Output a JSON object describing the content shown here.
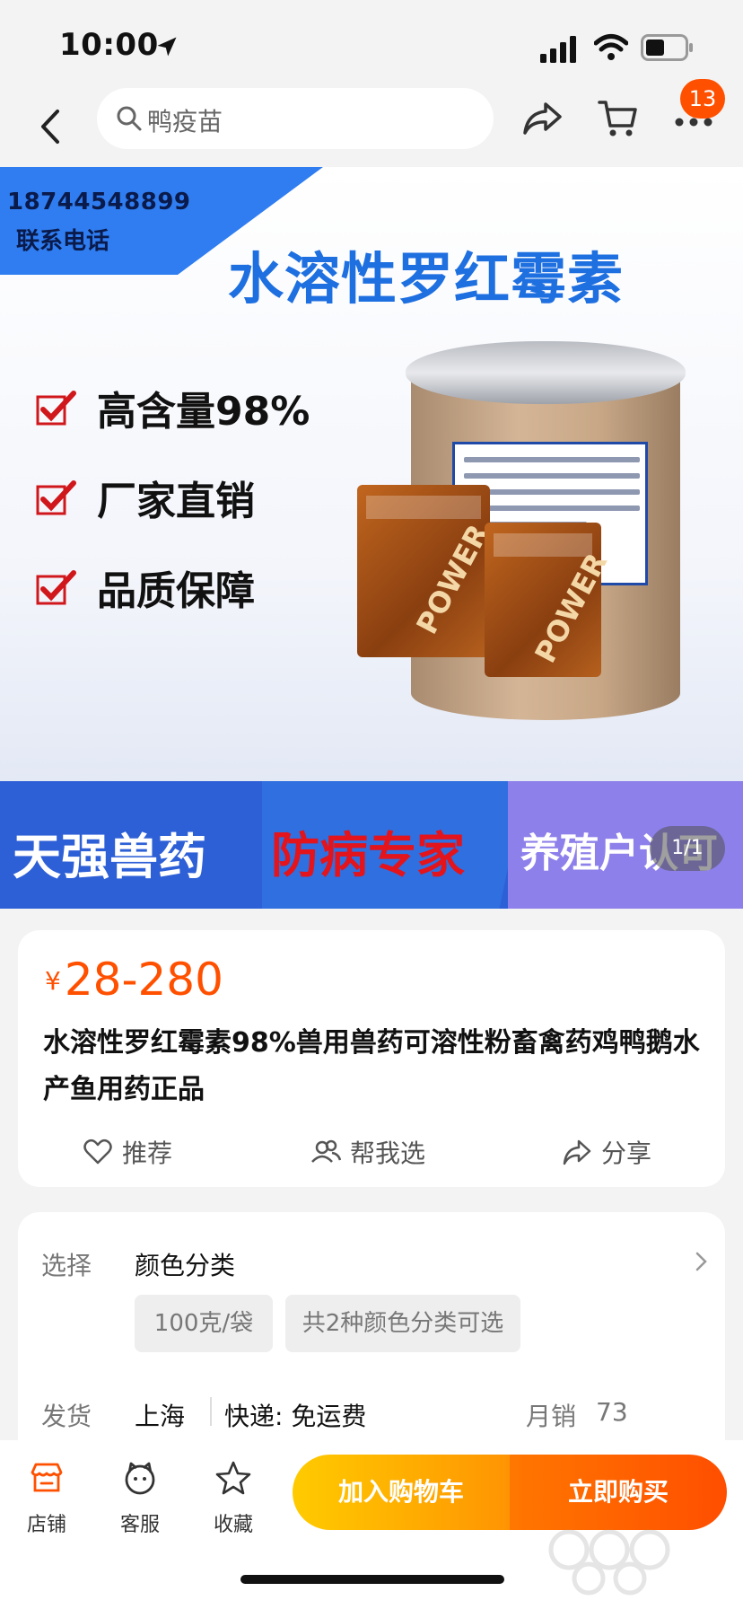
{
  "status": {
    "time": "10:00"
  },
  "nav": {
    "search_text": "鸭疫苗",
    "cart_badge": "13"
  },
  "hero": {
    "phone": "18744548899",
    "phone_label": "联系电话",
    "title": "水溶性罗红霉素",
    "checks": [
      "高含量98%",
      "厂家直销",
      "品质保障"
    ],
    "packet_text": "POWER",
    "banner": [
      "天强兽药",
      "防病专家",
      "养殖户认可"
    ],
    "pager": "1/1"
  },
  "product": {
    "currency": "¥",
    "price": "28-280",
    "title": "水溶性罗红霉素98%兽用兽药可溶性粉畜禽药鸡鸭鹅水产鱼用药正品",
    "actions": [
      "推荐",
      "帮我选",
      "分享"
    ]
  },
  "options": {
    "select_label": "选择",
    "select_value": "颜色分类",
    "chips": [
      "100克/袋",
      "共2种颜色分类可选"
    ],
    "ship_label": "发货",
    "ship_from": "上海",
    "delivery": "快递: 免运费",
    "monthly_sales_label": "月销",
    "monthly_sales": "73"
  },
  "bottom": {
    "tabs": [
      "店铺",
      "客服",
      "收藏"
    ],
    "add_cart": "加入购物车",
    "buy_now": "立即购买"
  },
  "colors": {
    "accent": "#ff5000",
    "hero_blue": "#1e6fe0"
  }
}
